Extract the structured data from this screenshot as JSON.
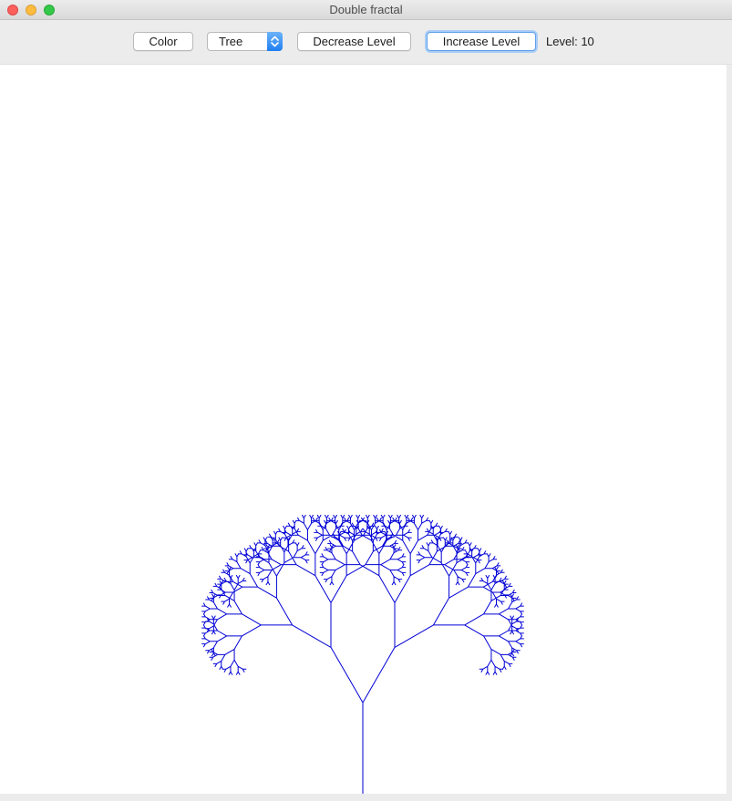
{
  "window": {
    "title": "Double fractal"
  },
  "toolbar": {
    "color_label": "Color",
    "shape_selected": "Tree",
    "decrease_label": "Decrease Level",
    "increase_label": "Increase Level",
    "level_prefix": "Level:",
    "level_value": "10"
  },
  "fractal": {
    "level": 10,
    "color": "#0000d6"
  },
  "colors": {
    "accent": "#3b8df0"
  }
}
